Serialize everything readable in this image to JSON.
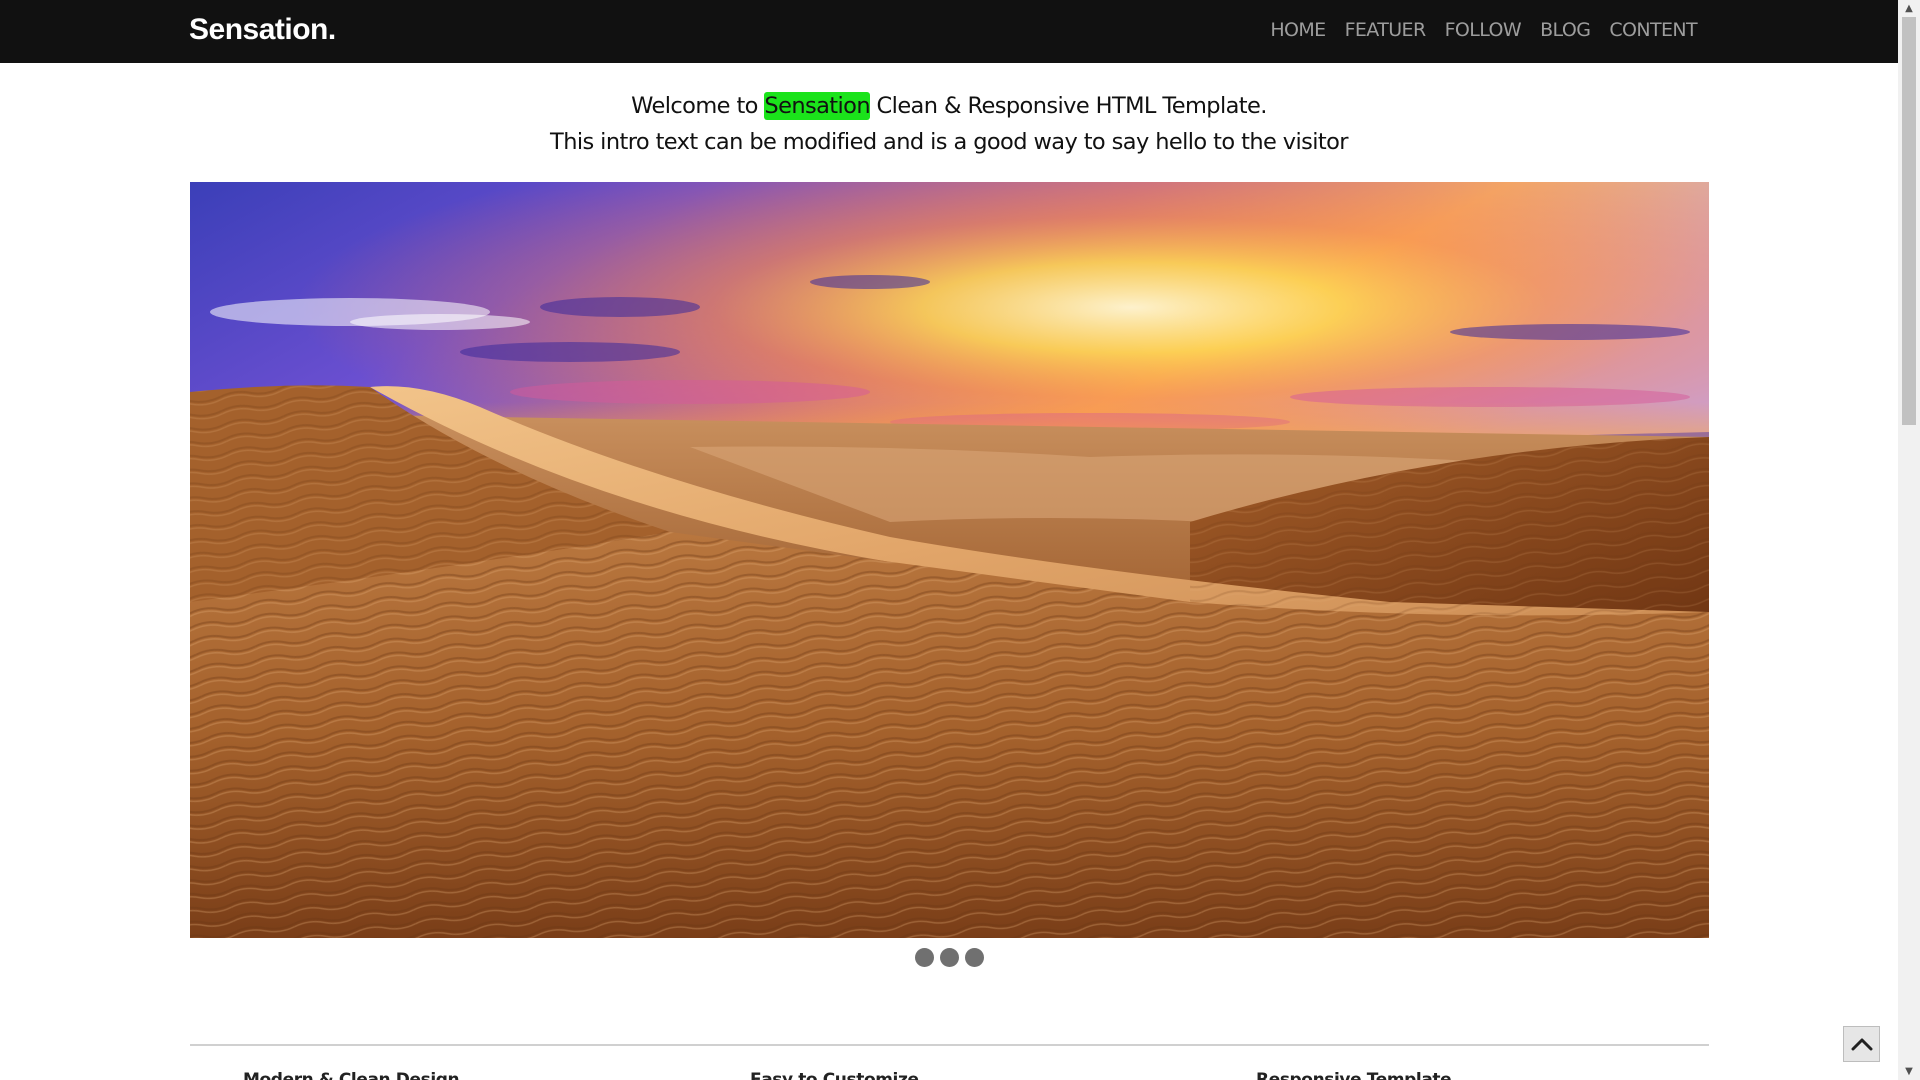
{
  "brand": "Sensation.",
  "nav": {
    "items": [
      "HOME",
      "FEATUER",
      "FOLLOW",
      "BLOG",
      "CONTENT"
    ]
  },
  "intro": {
    "prefix": "Welcome to ",
    "highlight": "Sensation",
    "suffix": " Clean & Responsive HTML Template.",
    "line2": "This intro text can be modified and is a good way to say hello to the visitor"
  },
  "slider": {
    "slide_count": 3
  },
  "features": [
    {
      "title": "Modern & Clean Design"
    },
    {
      "title": "Easy to Customize"
    },
    {
      "title": "Responsive Template"
    }
  ],
  "colors": {
    "navbar": "#111111",
    "highlight": "#1be31b",
    "nav_link": "#9d9d9d"
  }
}
